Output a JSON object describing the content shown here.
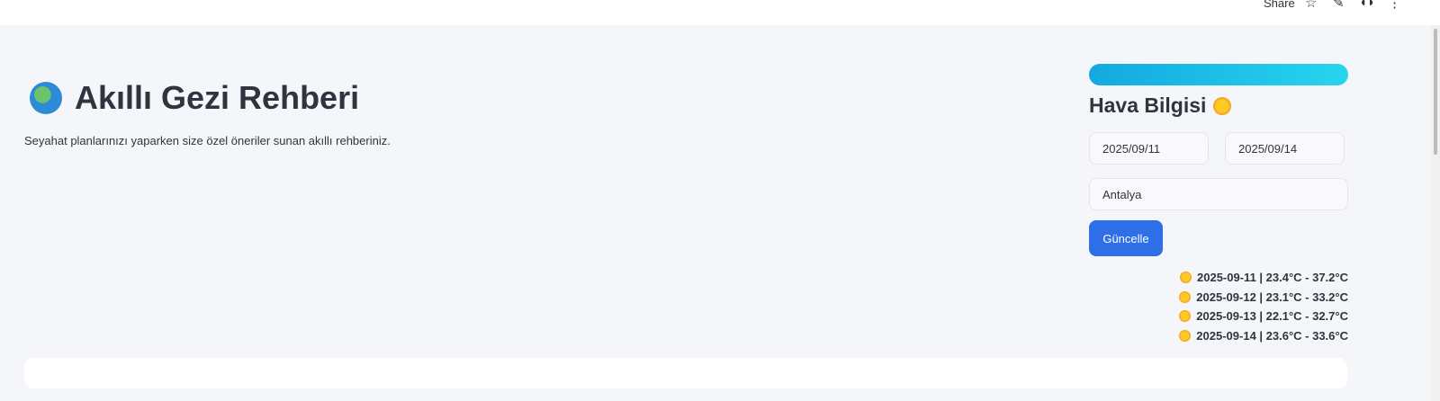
{
  "toolbar": {
    "share": "Share",
    "icons": [
      "star-icon",
      "pencil-icon",
      "github-icon",
      "more-icon"
    ]
  },
  "header": {
    "title": "Akıllı Gezi Rehberi",
    "subtitle": "Seyahat planlarınızı yaparken size özel öneriler sunan akıllı rehberiniz."
  },
  "weather": {
    "title": "Hava Bilgisi",
    "start_date": "2025/09/11",
    "end_date": "2025/09/14",
    "city": "Antalya",
    "update_label": "Güncelle",
    "days": [
      "2025-09-11 | 23.4°C - 37.2°C",
      "2025-09-12 | 23.1°C - 33.2°C",
      "2025-09-13 | 22.1°C - 32.7°C",
      "2025-09-14 | 23.6°C - 33.6°C"
    ]
  }
}
